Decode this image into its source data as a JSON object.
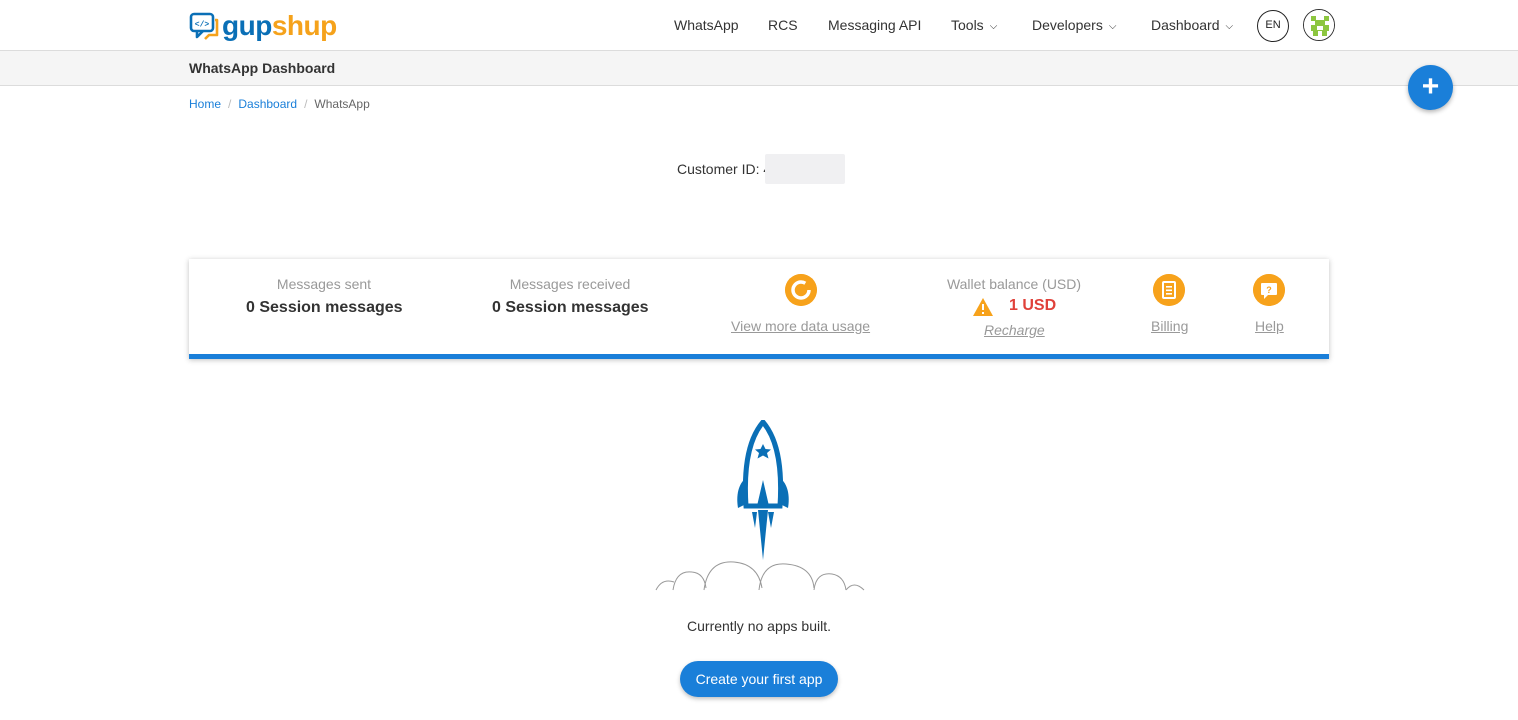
{
  "brand": {
    "part1": "gup",
    "part2": "shup"
  },
  "nav": {
    "whatsapp": "WhatsApp",
    "rcs": "RCS",
    "messaging_api": "Messaging API",
    "tools": "Tools",
    "developers": "Developers",
    "dashboard": "Dashboard",
    "language": "EN"
  },
  "subheader": {
    "title": "WhatsApp Dashboard"
  },
  "fab": {
    "label": "+"
  },
  "breadcrumb": {
    "home": "Home",
    "dashboard": "Dashboard",
    "current": "WhatsApp"
  },
  "customer": {
    "label": "Customer ID: ",
    "value": "4"
  },
  "stats": {
    "sent_label": "Messages sent",
    "sent_value": "0 Session messages",
    "received_label": "Messages received",
    "received_value": "0 Session messages",
    "usage_link": "View more data usage",
    "wallet_label": "Wallet balance (USD)",
    "wallet_value": "1 USD",
    "recharge_link": "Recharge",
    "billing_link": "Billing",
    "help_link": "Help"
  },
  "empty_state": {
    "message": "Currently no apps built.",
    "cta": "Create your first app"
  },
  "colors": {
    "primary": "#1a7fd9",
    "accent": "#f7a21b",
    "warning": "#e0413a",
    "brand_blue": "#0a6fb6",
    "brand_orange": "#f5a21b"
  }
}
